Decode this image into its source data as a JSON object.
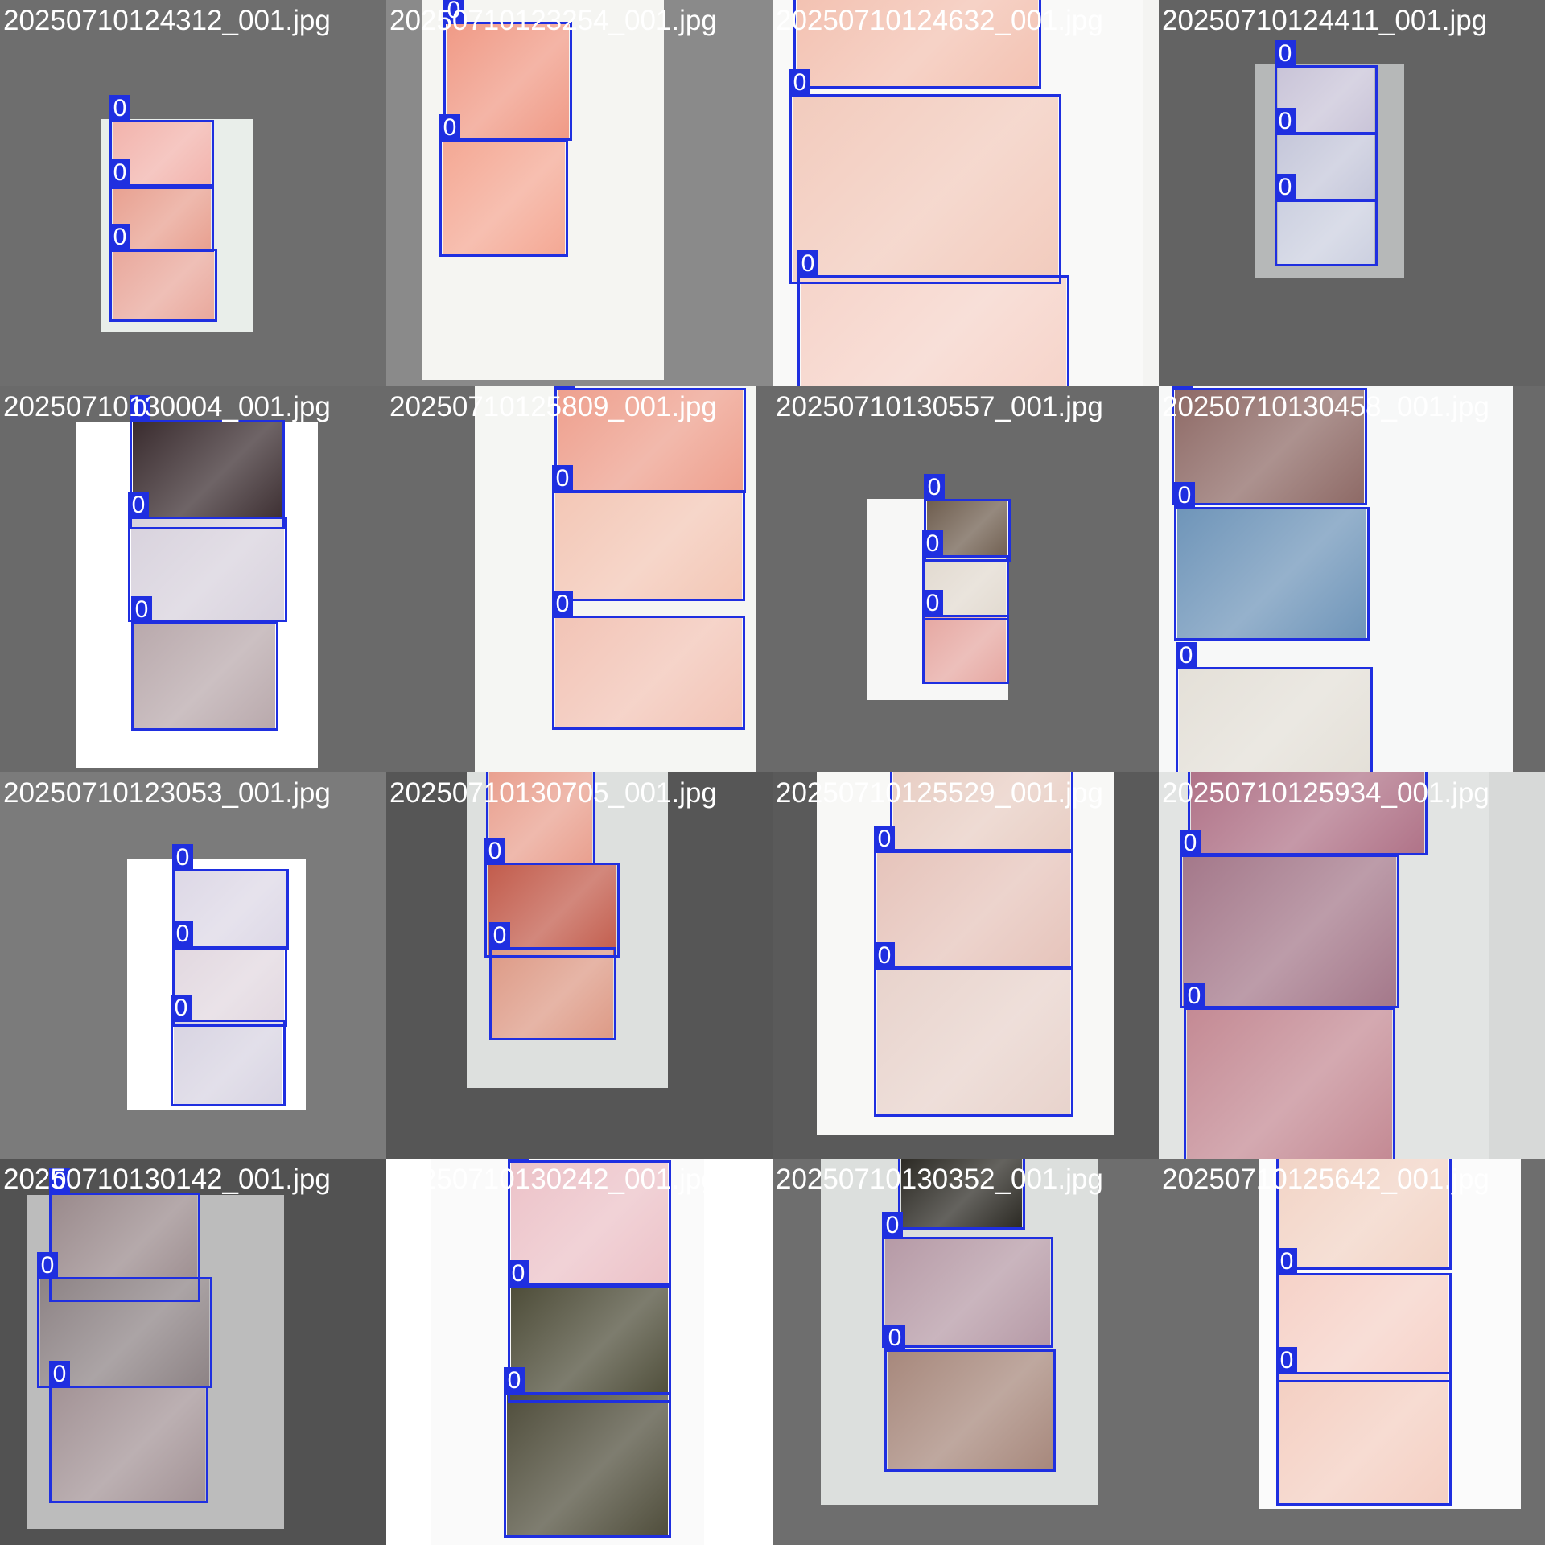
{
  "detection_label_color": "#1f2fe0",
  "tiles": [
    {
      "filename": "20250710124312_001.jpg",
      "background": "#6e6e6e",
      "paper_color": "#e9eeea",
      "photo_tones": [
        "#f2b3ac",
        "#e8a090",
        "#e9a89c"
      ],
      "detections": [
        {
          "label": "0"
        },
        {
          "label": "0"
        },
        {
          "label": "0"
        }
      ]
    },
    {
      "filename": "20250710123254_001.jpg",
      "background": "#8a8a8a",
      "paper_color": "#f5f5f2",
      "photo_tones": [
        "#f09a86",
        "#f4a894"
      ],
      "detections": [
        {
          "label": "0"
        },
        {
          "label": "0"
        }
      ]
    },
    {
      "filename": "20250710124632_001.jpg",
      "background": "#f4f4f2",
      "paper_color": "#f9f9f8",
      "photo_tones": [
        "#f3c2b2",
        "#f2cbbd",
        "#f6d4ca"
      ],
      "detections": [
        {
          "label": "0"
        },
        {
          "label": "0"
        },
        {
          "label": "0"
        }
      ]
    },
    {
      "filename": "20250710124411_001.jpg",
      "background": "#636363",
      "paper_color": "#b6b8b8",
      "photo_tones": [
        "#c9c4d8",
        "#c5c7da",
        "#ccd0e0"
      ],
      "detections": [
        {
          "label": "0"
        },
        {
          "label": "0"
        },
        {
          "label": "0"
        }
      ]
    },
    {
      "filename": "20250710130004_001.jpg",
      "background": "#6a6a6a",
      "paper_color": "#ffffff",
      "photo_tones": [
        "#3a2c2f",
        "#d8d2dd",
        "#b9a9ac"
      ],
      "detections": [
        {
          "label": "0"
        },
        {
          "label": "0"
        },
        {
          "label": "0"
        }
      ]
    },
    {
      "filename": "20250710125809_001.jpg",
      "background": "#6a6a6a",
      "paper_color": "#f5f6f3",
      "photo_tones": [
        "#eea08e",
        "#f3c7b6",
        "#f2c4b6"
      ],
      "detections": [
        {
          "label": "0"
        },
        {
          "label": "0"
        },
        {
          "label": "0"
        }
      ]
    },
    {
      "filename": "20250710130557_001.jpg",
      "background": "#6a6a6a",
      "paper_color": "#f7f7f6",
      "photo_tones": [
        "#6f5e4f",
        "#e2dad0",
        "#e6a8a2"
      ],
      "detections": [
        {
          "label": "0"
        },
        {
          "label": "0"
        },
        {
          "label": "0"
        }
      ]
    },
    {
      "filename": "20250710130458_001.jpg",
      "background": "#6a6a6a",
      "paper_color": "#f7f8f8",
      "photo_tones": [
        "#8e6a66",
        "#6f95b9",
        "#e4e0d8"
      ],
      "detections": [
        {
          "label": "0"
        },
        {
          "label": "0"
        },
        {
          "label": "0"
        }
      ]
    },
    {
      "filename": "20250710123053_001.jpg",
      "background": "#7b7b7b",
      "paper_color": "#ffffff",
      "photo_tones": [
        "#ddd8e6",
        "#e2d8e0",
        "#d8d4e2"
      ],
      "detections": [
        {
          "label": "0"
        },
        {
          "label": "0"
        },
        {
          "label": "0"
        }
      ]
    },
    {
      "filename": "20250710130705_001.jpg",
      "background": "#565656",
      "paper_color": "#dde0de",
      "photo_tones": [
        "#e9a08f",
        "#c25c4c",
        "#dd9a86"
      ],
      "detections": [
        {
          "label": "0"
        },
        {
          "label": "0"
        },
        {
          "label": "0"
        }
      ]
    },
    {
      "filename": "20250710125529_001.jpg",
      "background": "#5a5a5a",
      "paper_color": "#f8f8f6",
      "photo_tones": [
        "#e8cec4",
        "#e6c4bb",
        "#e8d3cc"
      ],
      "detections": [
        {
          "label": "0"
        },
        {
          "label": "0"
        },
        {
          "label": "0"
        }
      ]
    },
    {
      "filename": "20250710125934_001.jpg",
      "background": "#d7d9d8",
      "paper_color": "#e2e4e3",
      "photo_tones": [
        "#b07388",
        "#a4788a",
        "#c48a94"
      ],
      "detections": [
        {
          "label": "0"
        },
        {
          "label": "0"
        },
        {
          "label": "0"
        }
      ]
    },
    {
      "filename": "20250710130142_001.jpg",
      "background": "#525252",
      "paper_color": "#bcbcbc",
      "photo_tones": [
        "#9a8a8c",
        "#8d8385",
        "#a39396"
      ],
      "detections": [
        {
          "label": "0"
        },
        {
          "label": "0"
        },
        {
          "label": "0"
        }
      ]
    },
    {
      "filename": "20250710130242_001.jpg",
      "background": "#ffffff",
      "paper_color": "#fafafa",
      "photo_tones": [
        "#ecc2c8",
        "#4e4d39",
        "#504e3c"
      ],
      "detections": [
        {
          "label": "0"
        },
        {
          "label": "0"
        },
        {
          "label": "0"
        }
      ]
    },
    {
      "filename": "20250710130352_001.jpg",
      "background": "#6e6e6e",
      "paper_color": "#dcdfdd",
      "photo_tones": [
        "#2c2a24",
        "#b69aa6",
        "#a7887c"
      ],
      "detections": [
        {
          "label": "0"
        },
        {
          "label": "0"
        },
        {
          "label": "0"
        }
      ]
    },
    {
      "filename": "20250710125642_001.jpg",
      "background": "#6e6e6e",
      "paper_color": "#fbfbfb",
      "photo_tones": [
        "#f2d4c6",
        "#f6d2c8",
        "#f4cfc2"
      ],
      "detections": [
        {
          "label": "0"
        },
        {
          "label": "0"
        },
        {
          "label": "0"
        }
      ]
    }
  ]
}
